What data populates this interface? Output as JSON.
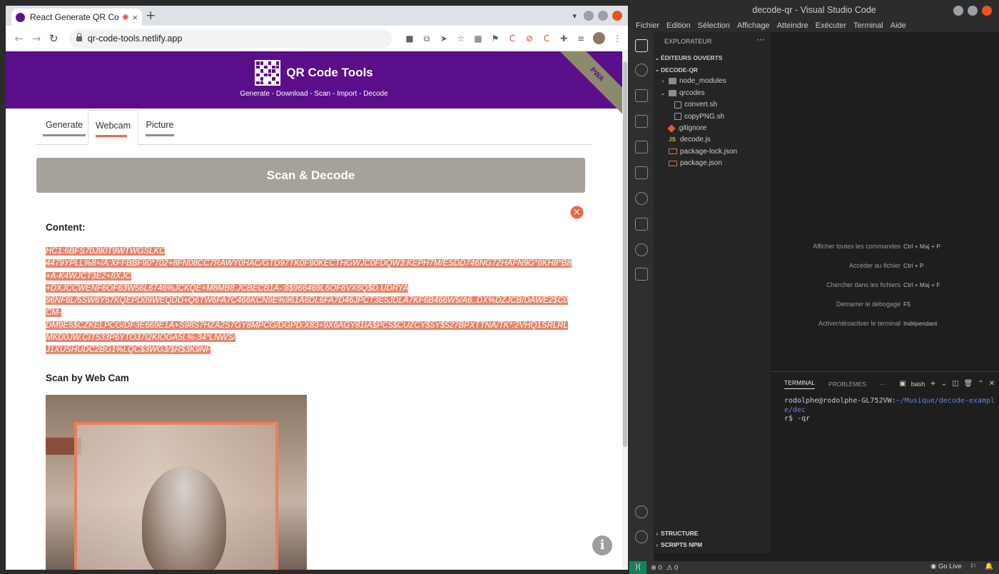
{
  "browser": {
    "tab_title": "React Generate QR Code",
    "tab_close": "×",
    "new_tab": "+",
    "url": "qr-code-tools.netlify.app",
    "nav": {
      "back": "←",
      "forward": "→",
      "reload": "↻"
    },
    "extension_icons": [
      "camera-icon",
      "open-external-icon",
      "send-icon",
      "star-icon",
      "qr-icon",
      "flag-icon",
      "c-extension-icon",
      "block-icon",
      "c-extension-icon",
      "puzzle-icon",
      "playlist-icon"
    ]
  },
  "site": {
    "title": "QR Code Tools",
    "tagline": "Generate - Download - Scan - Import - Decode",
    "pwa_badge": "PWA",
    "tabs": [
      {
        "label": "Generate"
      },
      {
        "label": "Webcam"
      },
      {
        "label": "Picture"
      }
    ],
    "active_tab": "Webcam",
    "scan_button": "Scan & Decode",
    "content_label": "Content:",
    "content_lines": [
      "HC1:6BFS70J90T9WTWGSLKC",
      "4479YPLL%8+/A:XFFBBF90*702+8FN08CC7RAWY0HAC/GTD97TK0F90KECTHGWJC0FDQW3:KEPH7M/ESDD746NG7ZHAFN9G*8KH8*B8",
      "+A-K4WJCT3E2+8XJC",
      "+DXJCCWENF6OF63W56L6746%JCKQE+M8MB8.JCBECB1A-:8$966469L6OF6VX6Q$D.UDRYA",
      "96NF6L/5SW6Y57KQEPD09WEQDD+Q6TW6FA7C466KCN9E%961A6DL6FA7D46JPCT3E5JDLA7KF6B466W5/A6..DX%DZJCB/DAWE2$C0",
      "CM-",
      "DM9E5$CZKELPCG/DF3E669E1A+S98S7HZA2S7GY8MPCG/DGPD:X83+9X6AGY81IA$PC5$CUZCY$5Y$527BPXTTNA/TK*:2VHQ1SRLRL",
      "MKD0JW.CIT533P6YTO37I2KIOGA5L%-34*LNWS/",
      "J1XUSHUDC2BG1%LQC$3WG3/$R$3K9NF"
    ],
    "webcam_label": "Scan by Web Cam",
    "close_glyph": "×",
    "info_glyph": "i"
  },
  "vscode": {
    "window_title": "decode-qr - Visual Studio Code",
    "menu": [
      "Fichier",
      "Edition",
      "Sélection",
      "Affichage",
      "Atteindre",
      "Exécuter",
      "Terminal",
      "Aide"
    ],
    "explorer_title": "EXPLORATEUR",
    "explorer_more": "···",
    "open_editors": "ÉDITEURS OUVERTS",
    "project": "DECODE-QR",
    "tree": [
      {
        "name": "node_modules",
        "kind": "folder"
      },
      {
        "name": "qrcodes",
        "kind": "folder-open"
      },
      {
        "name": "convert.sh",
        "kind": "sh"
      },
      {
        "name": "copyPNG.sh",
        "kind": "sh"
      },
      {
        "name": ".gitignore",
        "kind": "git"
      },
      {
        "name": "decode.js",
        "kind": "js"
      },
      {
        "name": "package-lock.json",
        "kind": "json"
      },
      {
        "name": "package.json",
        "kind": "json"
      }
    ],
    "js_badge": "JS",
    "bottom_sections": [
      "STRUCTURE",
      "SCRIPTS NPM"
    ],
    "shortcuts": [
      {
        "label": "Afficher toutes les commandes",
        "keys": "Ctrl + Maj + P"
      },
      {
        "label": "Accéder au fichier",
        "keys": "Ctrl + P"
      },
      {
        "label": "Chercher dans les fichiers",
        "keys": "Ctrl + Maj + F"
      },
      {
        "label": "Démarrer le débogage",
        "keys": "F5"
      },
      {
        "label": "Activer/désactiver le terminal",
        "keys": "Indépendant"
      }
    ],
    "panel_tabs": [
      "TERMINAL",
      "PROBLÈMES",
      "···"
    ],
    "terminal_shell": "bash",
    "terminal_user": "rodolphe@rodolphe-GL752VW",
    "terminal_sep": ":",
    "terminal_path": "~/Musique/decode-example/dec",
    "terminal_line2": "r$ -qr",
    "status": {
      "errors": "⊗ 0",
      "warnings": "⚠ 0",
      "golive": "Go Live"
    }
  },
  "colors": {
    "site_header": "#5a0e8a",
    "scan_button": "#a7a19c",
    "highlight": "#e5866d",
    "vscode_bg": "#1e1e1e"
  }
}
